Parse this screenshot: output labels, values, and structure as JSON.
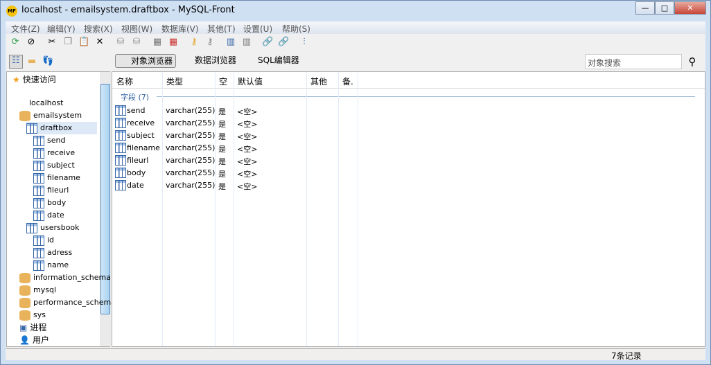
{
  "window": {
    "title": "localhost - emailsystem.draftbox - MySQL-Front",
    "logo": "MF"
  },
  "menu": [
    "文件(Z)",
    "编辑(Y)",
    "搜索(X)",
    "视图(W)",
    "数据库(V)",
    "其他(T)",
    "设置(U)",
    "帮助(S)"
  ],
  "views": {
    "object_browser": "对象浏览器",
    "data_browser": "数据浏览器",
    "sql_editor": "SQL编辑器"
  },
  "search": {
    "placeholder": "对象搜索"
  },
  "tree": {
    "quick_access": "快速访问",
    "host": "localhost",
    "db": "emailsystem",
    "tables": [
      {
        "name": "draftbox",
        "fields": [
          "send",
          "receive",
          "subject",
          "filename",
          "fileurl",
          "body",
          "date"
        ]
      },
      {
        "name": "usersbook",
        "fields": [
          "id",
          "adress",
          "name"
        ]
      }
    ],
    "other_dbs": [
      "information_schema",
      "mysql",
      "performance_schema",
      "sys"
    ],
    "processes": "进程",
    "users": "用户"
  },
  "grid": {
    "headers": [
      "名称",
      "类型",
      "空",
      "默认值",
      "其他",
      "备."
    ],
    "group": "字段 (7)",
    "rows": [
      [
        "send",
        "varchar(255)",
        "是",
        "<空>"
      ],
      [
        "receive",
        "varchar(255)",
        "是",
        "<空>"
      ],
      [
        "subject",
        "varchar(255)",
        "是",
        "<空>"
      ],
      [
        "filename",
        "varchar(255)",
        "是",
        "<空>"
      ],
      [
        "fileurl",
        "varchar(255)",
        "是",
        "<空>"
      ],
      [
        "body",
        "varchar(255)",
        "是",
        "<空>"
      ],
      [
        "date",
        "varchar(255)",
        "是",
        "<空>"
      ]
    ]
  },
  "status": {
    "records": "7条记录"
  }
}
